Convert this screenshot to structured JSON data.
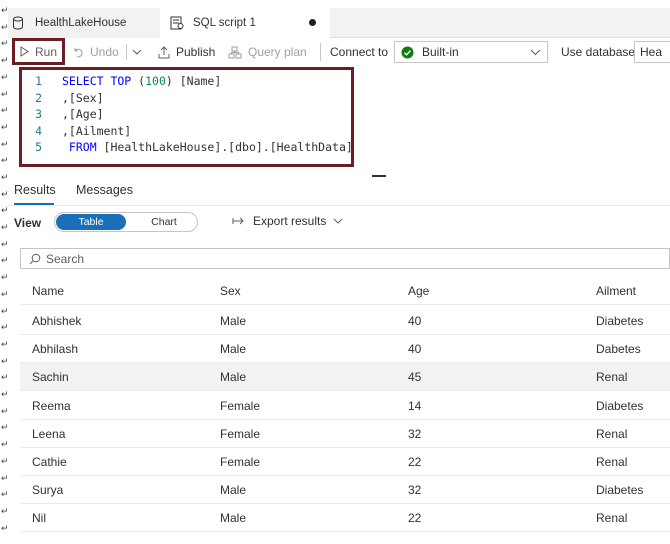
{
  "tabs": [
    {
      "label": "HealthLakeHouse",
      "icon": "database-icon",
      "active": false
    },
    {
      "label": "SQL script 1",
      "icon": "sql-script-icon",
      "active": true,
      "unsaved": true
    }
  ],
  "toolbar": {
    "run": "Run",
    "undo": "Undo",
    "publish": "Publish",
    "query_plan": "Query plan",
    "connect_to_label": "Connect to",
    "connect_to_value": "Built-in",
    "use_database_label": "Use database",
    "use_database_value": "Hea"
  },
  "editor": {
    "lines": [
      {
        "n": "1",
        "parts": [
          {
            "t": "SELECT TOP ",
            "k": "kw"
          },
          {
            "t": "(",
            "k": ""
          },
          {
            "t": "100",
            "k": "num"
          },
          {
            "t": ") [Name]",
            "k": ""
          }
        ]
      },
      {
        "n": "2",
        "parts": [
          {
            "t": ",[Sex]",
            "k": ""
          }
        ]
      },
      {
        "n": "3",
        "parts": [
          {
            "t": ",[Age]",
            "k": ""
          }
        ]
      },
      {
        "n": "4",
        "parts": [
          {
            "t": ",[Ailment]",
            "k": ""
          }
        ]
      },
      {
        "n": "5",
        "parts": [
          {
            "t": " FROM ",
            "k": "kw"
          },
          {
            "t": "[HealthLakeHouse].[dbo].[HealthData]",
            "k": ""
          }
        ]
      }
    ]
  },
  "results": {
    "tabs": [
      "Results",
      "Messages"
    ],
    "view_label": "View",
    "view_options": [
      "Table",
      "Chart"
    ],
    "export_label": "Export results",
    "search_placeholder": "Search",
    "columns": [
      "Name",
      "Sex",
      "Age",
      "Ailment"
    ],
    "rows": [
      [
        "Abhishek",
        "Male",
        "40",
        "Diabetes"
      ],
      [
        "Abhilash",
        "Male",
        "40",
        "Dabetes"
      ],
      [
        "Sachin",
        "Male",
        "45",
        "Renal"
      ],
      [
        "Reema",
        "Female",
        "14",
        "Diabetes"
      ],
      [
        "Leena",
        "Female",
        "32",
        "Renal"
      ],
      [
        "Cathie",
        "Female",
        "22",
        "Renal"
      ],
      [
        "Surya",
        "Male",
        "32",
        "Diabetes"
      ],
      [
        "Nil",
        "Male",
        "22",
        "Renal"
      ]
    ],
    "selected_row": 2
  },
  "colors": {
    "accent": "#1a6fb8",
    "highlight_border": "#6b1d24",
    "check_green": "#107c10"
  }
}
